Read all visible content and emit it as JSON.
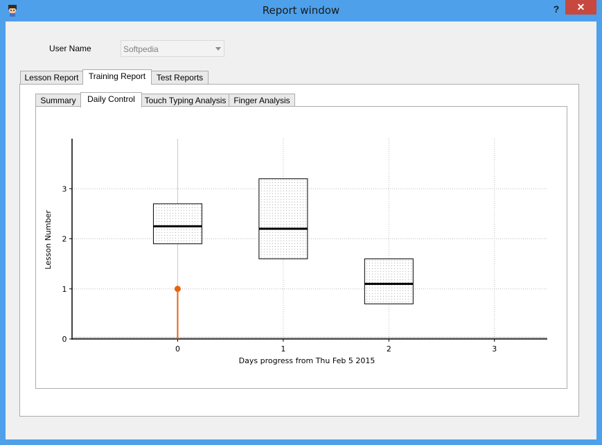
{
  "window": {
    "title": "Report window",
    "help_label": "?",
    "close_label": "✕",
    "icon": "app-character-icon"
  },
  "user": {
    "label": "User Name",
    "value": "Softpedia"
  },
  "main_tabs": [
    {
      "label": "Lesson Report",
      "active": false
    },
    {
      "label": "Training Report",
      "active": true
    },
    {
      "label": "Test Reports",
      "active": false
    }
  ],
  "sub_tabs": [
    {
      "label": "Summary",
      "active": false
    },
    {
      "label": "Daily Control",
      "active": true
    },
    {
      "label": "Touch Typing Analysis",
      "active": false
    },
    {
      "label": "Finger Analysis",
      "active": false
    }
  ],
  "chart_data": {
    "type": "box",
    "xlabel": "Days progress from Thu Feb 5 2015",
    "ylabel": "Lesson Number",
    "x_ticks": [
      "0",
      "1",
      "2",
      "3"
    ],
    "y_ticks": [
      "0",
      "1",
      "2",
      "3"
    ],
    "xlim": [
      -1,
      3.5
    ],
    "ylim": [
      0,
      4
    ],
    "grid": true,
    "boxes": [
      {
        "x": 0,
        "q1": 1.9,
        "median": 2.25,
        "q3": 2.7
      },
      {
        "x": 1,
        "q1": 1.6,
        "median": 2.2,
        "q3": 3.2
      },
      {
        "x": 2,
        "q1": 0.7,
        "median": 1.1,
        "q3": 1.6
      }
    ],
    "stems": [
      {
        "x": 0,
        "y": 1,
        "color": "#e8640c"
      }
    ]
  }
}
